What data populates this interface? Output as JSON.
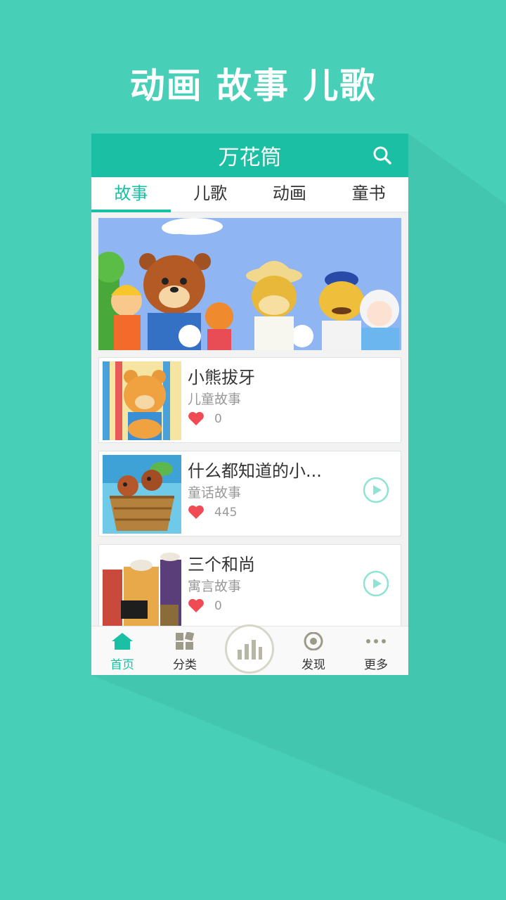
{
  "headline": "动画 故事 儿歌",
  "app": {
    "title": "万花筒"
  },
  "tabs": [
    {
      "label": "故事",
      "active": true
    },
    {
      "label": "儿歌",
      "active": false
    },
    {
      "label": "动画",
      "active": false
    },
    {
      "label": "童书",
      "active": false
    }
  ],
  "list": [
    {
      "title": "小熊拔牙",
      "category": "儿童故事",
      "likes": "0"
    },
    {
      "title": " 什么都知道的小...",
      "category": "童话故事",
      "likes": "445"
    },
    {
      "title": "三个和尚",
      "category": "寓言故事",
      "likes": "0"
    }
  ],
  "bottom_nav": {
    "home": "首页",
    "category": "分类",
    "discover": "发现",
    "more": "更多"
  },
  "colors": {
    "background": "#48cfb8",
    "accent": "#1bbfa3",
    "heart": "#f04a55"
  }
}
